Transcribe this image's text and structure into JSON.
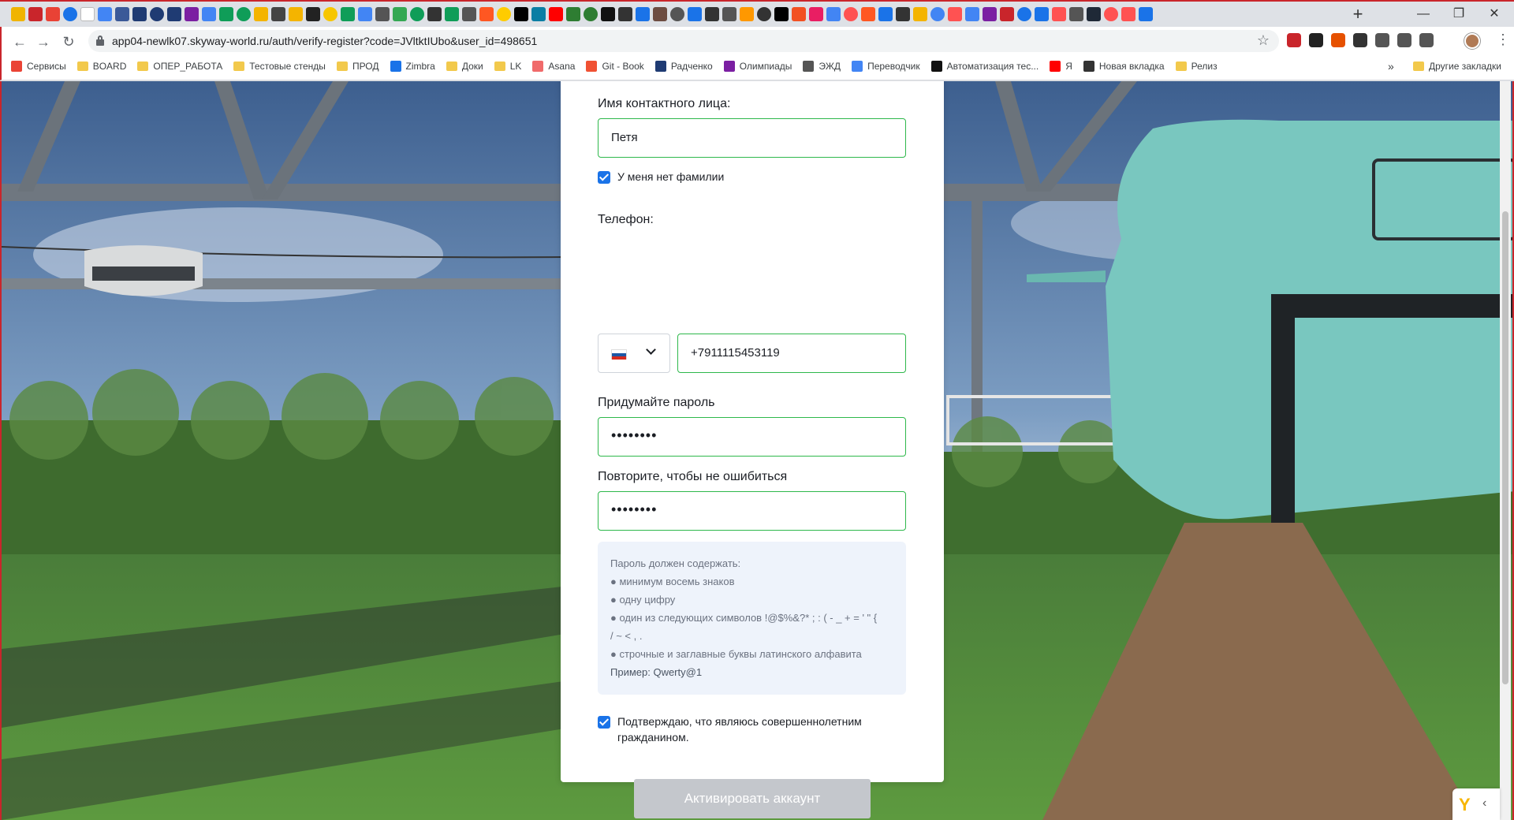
{
  "browser": {
    "url": "app04-newlk07.skyway-world.ru/auth/verify-register?code=JVltktIUbo&user_id=498651",
    "tab_favicon_colors": [
      "#f0b400",
      "#c9252b",
      "#e94235",
      "#1a73e8",
      "#ffffff",
      "#4285f4",
      "#3b5998",
      "#1f3b73",
      "#1f3b73",
      "#1f3b73",
      "#7b1fa2",
      "#4285f4",
      "#0f9d58",
      "#0f9d58",
      "#f4b400",
      "#444444",
      "#f4b400",
      "#222222",
      "#f7c600",
      "#0f9d58",
      "#4285f4",
      "#555555",
      "#34a853",
      "#0f9d58",
      "#333333",
      "#0f9d58",
      "#555555",
      "#ff5722",
      "#ffcc00",
      "#000000",
      "#0a7ea4",
      "#ff0000",
      "#2e7d32",
      "#2e7d32",
      "#111111",
      "#333333",
      "#1a73e8",
      "#6d4c41",
      "#555555",
      "#1a73e8",
      "#333333",
      "#555555",
      "#ff9800",
      "#333333",
      "#000000",
      "#f25022",
      "#e91e63",
      "#4285f4",
      "#ff5252",
      "#ff5722",
      "#1a73e8",
      "#333333",
      "#f4b400",
      "#4285f4",
      "#ff5252",
      "#4285f4",
      "#7b1fa2",
      "#c9252b",
      "#1a73e8",
      "#1a73e8",
      "#ff5252",
      "#555555",
      "#1f2937",
      "#ff5252",
      "#ff5252",
      "#1a73e8"
    ],
    "new_tab_symbol": "+",
    "window_controls": {
      "minimize": "—",
      "restore": "❐",
      "close": "✕"
    },
    "nav": {
      "back": "←",
      "forward": "→",
      "reload": "↻"
    },
    "star_symbol": "☆",
    "menu_symbol": "⋮",
    "bookmarks": [
      {
        "label": "Сервисы",
        "icon": "apps-icon",
        "color": "#ea4335"
      },
      {
        "label": "BOARD",
        "icon": "folder-icon",
        "color": "#f2c94c"
      },
      {
        "label": "ОПЕР_РАБОТА",
        "icon": "folder-icon",
        "color": "#f2c94c"
      },
      {
        "label": "Тестовые стенды",
        "icon": "folder-icon",
        "color": "#f2c94c"
      },
      {
        "label": "ПРОД",
        "icon": "folder-icon",
        "color": "#f2c94c"
      },
      {
        "label": "Zimbra",
        "icon": "zimbra-icon",
        "color": "#1a73e8"
      },
      {
        "label": "Доки",
        "icon": "folder-icon",
        "color": "#f2c94c"
      },
      {
        "label": "LK",
        "icon": "folder-icon",
        "color": "#f2c94c"
      },
      {
        "label": "Asana",
        "icon": "asana-icon",
        "color": "#f06a6a"
      },
      {
        "label": "Git - Book",
        "icon": "git-icon",
        "color": "#f05133"
      },
      {
        "label": "Радченко",
        "icon": "shield-icon",
        "color": "#1f3b73"
      },
      {
        "label": "Олимпиады",
        "icon": "olympiad-icon",
        "color": "#7b1fa2"
      },
      {
        "label": "ЭЖД",
        "icon": "journal-icon",
        "color": "#555555"
      },
      {
        "label": "Переводчик",
        "icon": "translate-icon",
        "color": "#4285f4"
      },
      {
        "label": "Автоматизация тес...",
        "icon": "automation-icon",
        "color": "#111111"
      },
      {
        "label": "Я",
        "icon": "yandex-icon",
        "color": "#ff0000"
      },
      {
        "label": "Новая вкладка",
        "icon": "globe-icon",
        "color": "#333333"
      },
      {
        "label": "Релиз",
        "icon": "folder-icon",
        "color": "#f2c94c"
      }
    ],
    "bookmarks_more": "»",
    "other_bookmarks": "Другие закладки",
    "extension_colors": [
      "#c9252b",
      "#222222",
      "#e65100",
      "#333333",
      "#555555",
      "#555555",
      "#555555"
    ]
  },
  "form": {
    "contact_name_label": "Имя контактного лица:",
    "contact_name_value": "Петя",
    "no_surname_label": "У меня нет фамилии",
    "no_surname_checked": true,
    "phone_label": "Телефон:",
    "phone_country": "RU",
    "phone_value": "+7911115453119",
    "password_label": "Придумайте пароль",
    "password_value": "••••••••",
    "password_repeat_label": "Повторите, чтобы не ошибиться",
    "password_repeat_value": "••••••••",
    "hint": {
      "title": "Пароль должен содержать:",
      "items": [
        "● минимум восемь знаков",
        "● одну цифру",
        "● один из следующих символов !@$%&?* ; : ( - _ + = ' \" {",
        "/ ~ < , .",
        "● строчные и заглавные буквы латинского алфавита"
      ],
      "example": "Пример: Qwerty@1"
    },
    "adult_confirm_line1": "Подтверждаю, что являюсь совершеннолетним",
    "adult_confirm_line2": "гражданином.",
    "adult_confirm_checked": true,
    "submit_label": "Активировать аккаунт",
    "submit_enabled": false
  }
}
